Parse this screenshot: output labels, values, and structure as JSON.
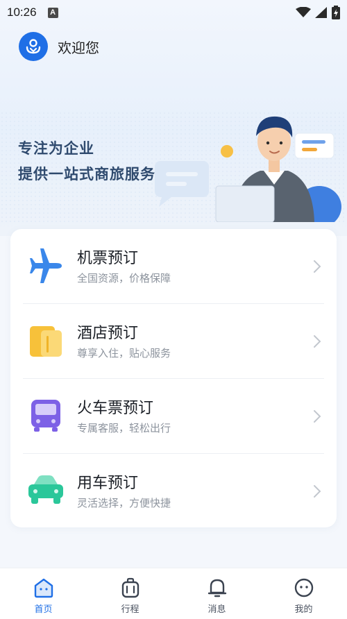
{
  "status_bar": {
    "time": "10:26",
    "notification_glyph": "A",
    "icons": [
      "wifi-icon",
      "signal-icon",
      "battery-charging-icon"
    ]
  },
  "header": {
    "welcome": "欢迎您",
    "logo_icon": "company-logo-icon"
  },
  "hero": {
    "line1": "专注为企业",
    "line2": "提供一站式商旅服务"
  },
  "services": [
    {
      "title": "机票预订",
      "subtitle": "全国资源，价格保障",
      "icon": "airplane-icon"
    },
    {
      "title": "酒店预订",
      "subtitle": "尊享入住，贴心服务",
      "icon": "hotel-icon"
    },
    {
      "title": "火车票预订",
      "subtitle": "专属客服，轻松出行",
      "icon": "train-icon"
    },
    {
      "title": "用车预订",
      "subtitle": "灵活选择，方便快捷",
      "icon": "car-icon"
    }
  ],
  "tabbar": {
    "items": [
      {
        "label": "首页",
        "icon": "home-icon",
        "active": true
      },
      {
        "label": "行程",
        "icon": "luggage-icon",
        "active": false
      },
      {
        "label": "消息",
        "icon": "bell-icon",
        "active": false
      },
      {
        "label": "我的",
        "icon": "profile-icon",
        "active": false
      }
    ]
  },
  "colors": {
    "accent": "#1f6fe6",
    "hero_text": "#2f4a6e",
    "subtitle": "#8c939d"
  }
}
